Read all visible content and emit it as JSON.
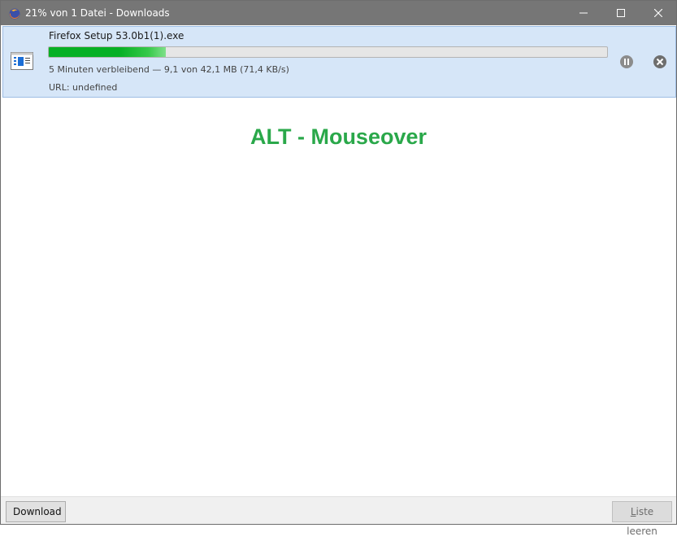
{
  "window": {
    "title": "21% von 1 Datei - Downloads",
    "icon": "firefox-icon"
  },
  "download": {
    "file_name": "Firefox Setup 53.0b1(1).exe",
    "progress_percent": 21,
    "status": "5 Minuten verbleibend — 9,1 von 42,1 MB (71,4 KB/s)",
    "url": "URL: undefined",
    "file_icon": "executable-file-icon",
    "pause_icon": "pause-icon",
    "cancel_icon": "cancel-icon"
  },
  "overlay": {
    "label": "ALT - Mouseover",
    "color": "#2aa84a"
  },
  "footer": {
    "download_button": "Download",
    "clear_list_button": "Liste leeren"
  },
  "colors": {
    "titlebar": "#767676",
    "item_background": "#d6e6f8",
    "progress": "#06b025"
  }
}
